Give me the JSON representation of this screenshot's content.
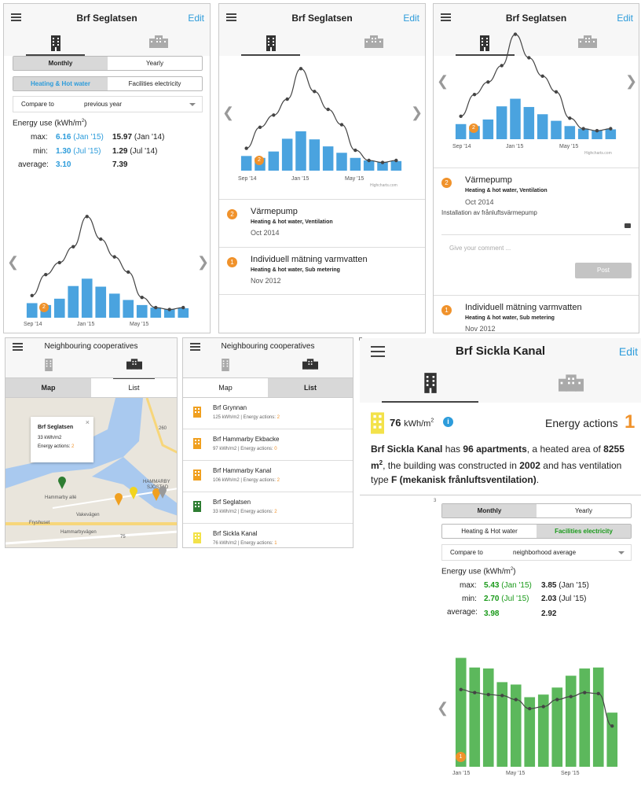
{
  "brand_colors": {
    "blue": "#2d9cdb",
    "orange": "#f0922b",
    "green": "#5cb85c",
    "yellow": "#f3e24a"
  },
  "screen1": {
    "title": "Brf Seglatsen",
    "edit": "Edit",
    "period_tabs": [
      "Monthly",
      "Yearly"
    ],
    "type_tabs": [
      "Heating & Hot water",
      "Facilities electricity"
    ],
    "compare_label": "Compare to",
    "compare_value": "previous year",
    "energy_label": "Energy use (kWh/m",
    "energy_sup": "2",
    "energy_close": ")",
    "max_label": "max:",
    "max_a": "6.16",
    "max_a_date": "(Jan '15)",
    "max_b": "15.97",
    "max_b_date": "(Jan '14)",
    "min_label": "min:",
    "min_a": "1.30",
    "min_a_date": "(Jul '15)",
    "min_b": "1.29",
    "min_b_date": "(Jul '14)",
    "avg_label": "average:",
    "avg_a": "3.10",
    "avg_b": "7.39",
    "badge": "2",
    "x_labels": [
      "Sep '14",
      "Jan '15",
      "May '15"
    ]
  },
  "screen2": {
    "title": "Brf Seglatsen",
    "edit": "Edit",
    "highcharts": "Highcharts.com",
    "x_labels": [
      "Sep '14",
      "Jan '15",
      "May '15"
    ],
    "badge": "2",
    "events": [
      {
        "badge": "2",
        "title": "Värmepump",
        "sub": "Heating & hot water, Ventilation",
        "date": "Oct 2014"
      },
      {
        "badge": "1",
        "title": "Individuell mätning varmvatten",
        "sub": "Heating & hot water, Sub metering",
        "date": "Nov 2012"
      }
    ]
  },
  "screen3": {
    "title": "Brf Seglatsen",
    "edit": "Edit",
    "highcharts": "Highcharts.com",
    "x_labels": [
      "Sep '14",
      "Jan '15",
      "May '15"
    ],
    "badge": "2",
    "event1": {
      "badge": "2",
      "title": "Värmepump",
      "sub": "Heating & hot water, Ventilation",
      "date": "Oct 2014",
      "note": "Installation av frånluftsvärmepump"
    },
    "comment_placeholder": "Give your comment ...",
    "post": "Post",
    "event2": {
      "badge": "1",
      "title": "Individuell mätning varmvatten",
      "sub": "Heating & hot water, Sub metering",
      "date": "Nov 2012"
    }
  },
  "screen4": {
    "title": "Neighbouring cooperatives",
    "tabs": [
      "Map",
      "List"
    ],
    "popup_title": "Brf Seglatsen",
    "popup_kwh": "33 kWh/m2",
    "popup_actions_label": "Energy actions: ",
    "popup_actions": "2",
    "close": "×",
    "streets": [
      "Hammarby allé",
      "Vakevägen",
      "Hammarbyvägen",
      "Fryshuset",
      "HAMMARBY",
      "SJÖSTAD",
      "260",
      "75"
    ]
  },
  "screen5": {
    "title": "Neighbouring cooperatives",
    "tabs": [
      "Map",
      "List"
    ],
    "items": [
      {
        "name": "Brf Grynnan",
        "meta": "125 kWh/m2 | Energy actions: ",
        "actions": "2"
      },
      {
        "name": "Brf Hammarby Ekbacke",
        "meta": "97 kWh/m2 | Energy actions: ",
        "actions": "0"
      },
      {
        "name": "Brf Hammarby Kanal",
        "meta": "106 kWh/m2 | Energy actions: ",
        "actions": "2"
      },
      {
        "name": "Brf Seglatsen",
        "meta": "33 kWh/m2 | Energy actions: ",
        "actions": "2"
      },
      {
        "name": "Brf Sickla Kanal",
        "meta": "76 kWh/m2 | Energy actions: ",
        "actions": "1"
      }
    ]
  },
  "screen6": {
    "title": "Brf Sickla Kanal",
    "edit": "Edit",
    "kwh_value": "76",
    "kwh_unit": "kWh/m",
    "kwh_sup": "2",
    "energy_actions_label": "Energy actions",
    "energy_actions": "1",
    "desc": {
      "p1": "Brf Sickla Kanal",
      "p2": " has ",
      "p3": "96 apartments",
      "p4": ", a heated area of ",
      "p5": "8255 m",
      "p6": "2",
      "p7": ", the building was constructed in ",
      "p8": "2002",
      "p9": " and has ventilation type ",
      "p10": "F (mekanisk frånluftsventilation)",
      "p11": "."
    },
    "stray": "3",
    "period_tabs": [
      "Monthly",
      "Yearly"
    ],
    "type_tabs": [
      "Heating & Hot water",
      "Facilities electricity"
    ],
    "compare_label": "Compare to",
    "compare_value": "neighborhood average",
    "energy_label": "Energy use (kWh/m",
    "energy_sup": "2",
    "energy_close": ")",
    "max_label": "max:",
    "max_a": "5.43",
    "max_a_date": "(Jan '15)",
    "max_b": "3.85",
    "max_b_date": "(Jan '15)",
    "min_label": "min:",
    "min_a": "2.70",
    "min_a_date": "(Jul '15)",
    "min_b": "2.03",
    "min_b_date": "(Jul '15)",
    "avg_label": "average:",
    "avg_a": "3.98",
    "avg_b": "2.92",
    "badge": "1",
    "x_labels": [
      "Jan '15",
      "May '15",
      "Sep '15"
    ]
  },
  "chart_data": [
    {
      "type": "bar",
      "ylabel": "",
      "xlabel": "",
      "categories": [
        "Sep '14",
        "Oct '14",
        "Nov '14",
        "Dec '14",
        "Jan '15",
        "Feb '15",
        "Mar '15",
        "Apr '15",
        "May '15",
        "Jun '15",
        "Jul '15",
        "Aug '15"
      ],
      "series": [
        {
          "type": "bar",
          "values": [
            2.3,
            2.0,
            3.0,
            5.0,
            6.16,
            4.9,
            3.8,
            2.8,
            2.0,
            1.6,
            1.3,
            1.5
          ]
        },
        {
          "type": "line",
          "values": [
            3.5,
            6.8,
            8.7,
            11.2,
            15.97,
            12.4,
            9.6,
            7.2,
            3.2,
            1.6,
            1.29,
            1.6
          ]
        }
      ],
      "ylim": [
        0,
        17
      ]
    },
    {
      "type": "bar",
      "ylabel": "",
      "xlabel": "",
      "categories": [
        "Jan '15",
        "Feb '15",
        "Mar '15",
        "Apr '15",
        "May '15",
        "Jun '15",
        "Jul '15",
        "Aug '15",
        "Sep '15",
        "Oct '15",
        "Nov '15",
        "Dec '15"
      ],
      "series": [
        {
          "type": "bar",
          "values": [
            5.43,
            4.95,
            4.9,
            4.22,
            4.1,
            3.47,
            3.6,
            3.95,
            4.54,
            4.9,
            4.95,
            2.7
          ]
        },
        {
          "type": "line",
          "values": [
            3.85,
            3.7,
            3.6,
            3.55,
            3.35,
            2.9,
            3.0,
            3.35,
            3.5,
            3.7,
            3.65,
            2.03
          ]
        }
      ],
      "ylim": [
        0,
        6
      ]
    }
  ]
}
